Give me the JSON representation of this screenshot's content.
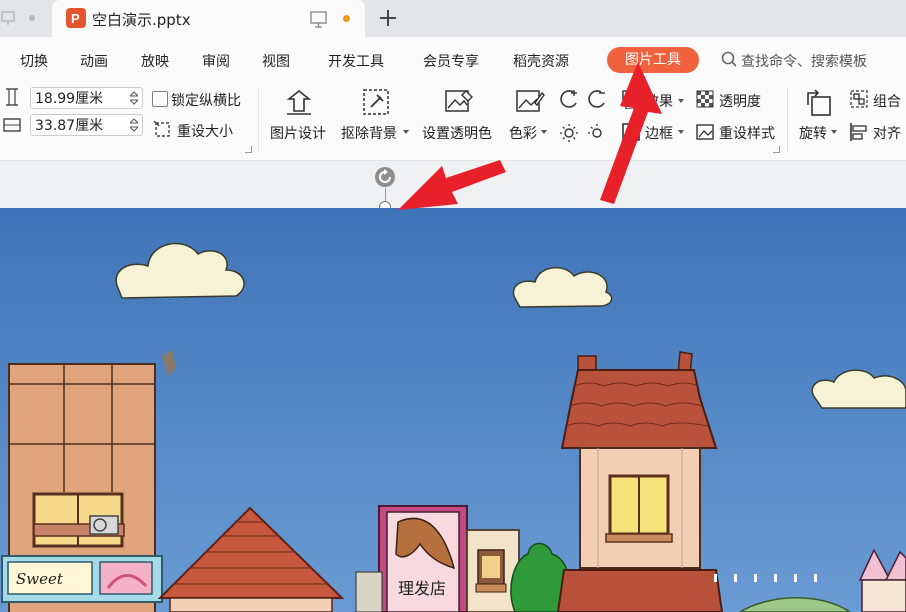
{
  "tabbar": {
    "document_tab_title": "空白演示.pptx",
    "icons": [
      "monitor-icon",
      "unsaved-dot",
      "plus-icon"
    ]
  },
  "menubar": {
    "items": [
      "切换",
      "动画",
      "放映",
      "审阅",
      "视图",
      "开发工具",
      "会员专享",
      "稻壳资源"
    ],
    "active_tool": "图片工具",
    "search_placeholder": "查找命令、搜索模板"
  },
  "ribbon": {
    "height_value": "18.99厘米",
    "width_value": "33.87厘米",
    "lock_ratio_label": "锁定纵横比",
    "reset_size_label": "重设大小",
    "picture_design_label": "图片设计",
    "remove_background_label": "抠除背景",
    "set_transparent_color_label": "设置透明色",
    "color_label": "色彩",
    "effect_label": "效果",
    "transparency_label": "透明度",
    "border_label": "边框",
    "reset_style_label": "重设样式",
    "rotate_label": "旋转",
    "group_label": "组合",
    "align_label": "对齐"
  },
  "picture": {
    "sign_text": "理发店",
    "shop_sign_text": "Sweet",
    "colors": {
      "sky": "#4a7fc3",
      "roof": "#b8523a",
      "wall": "#f2cfb3"
    }
  },
  "annotations": {
    "arrow_color": "#e8202a"
  }
}
